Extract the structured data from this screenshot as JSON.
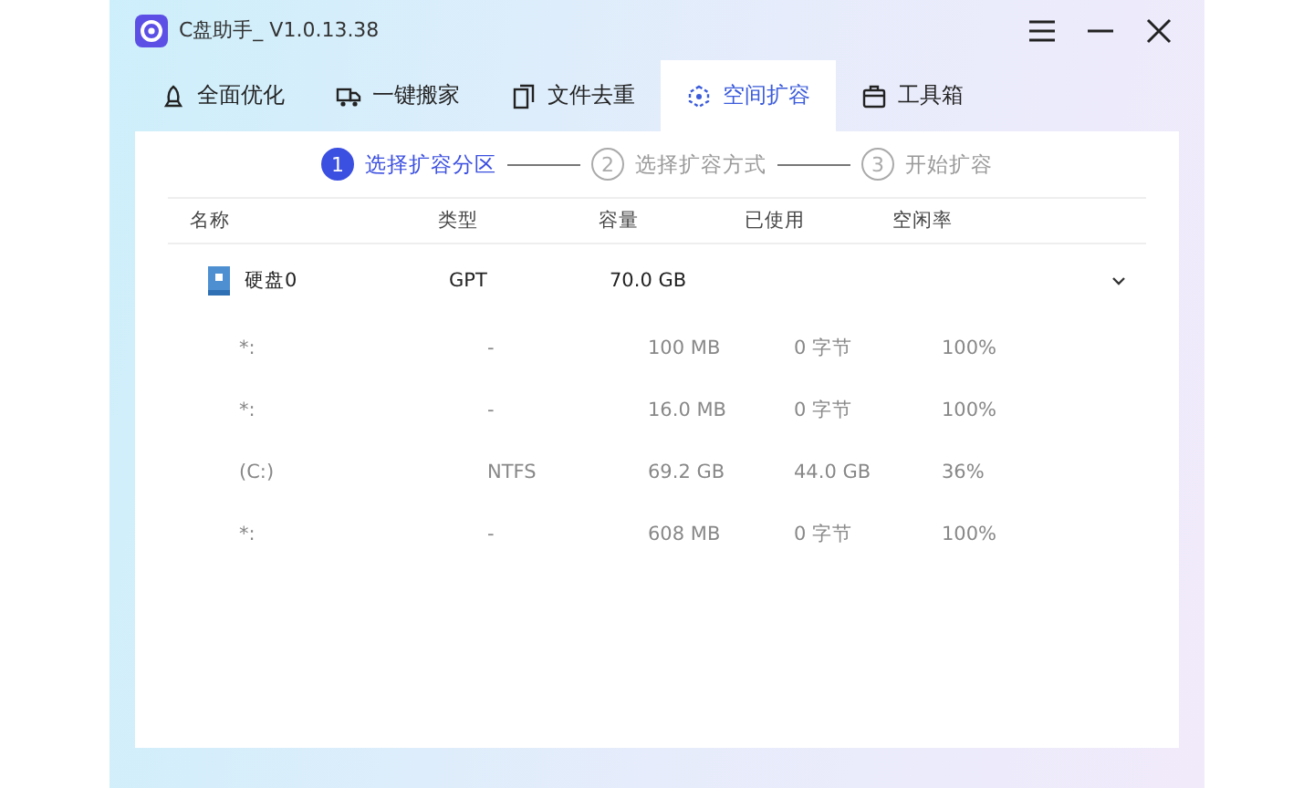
{
  "window": {
    "title": "C盘助手_ V1.0.13.38"
  },
  "tabs": [
    {
      "label": "全面优化",
      "selected": false
    },
    {
      "label": "一键搬家",
      "selected": false
    },
    {
      "label": "文件去重",
      "selected": false
    },
    {
      "label": "空间扩容",
      "selected": true
    },
    {
      "label": "工具箱",
      "selected": false
    }
  ],
  "steps": [
    {
      "number": "1",
      "label": "选择扩容分区",
      "active": true
    },
    {
      "number": "2",
      "label": "选择扩容方式",
      "active": false
    },
    {
      "number": "3",
      "label": "开始扩容",
      "active": false
    }
  ],
  "table": {
    "columns": [
      "名称",
      "类型",
      "容量",
      "已使用",
      "空闲率"
    ],
    "disk": {
      "name": "硬盘0",
      "type": "GPT",
      "capacity": "70.0 GB",
      "expanded": true
    },
    "rows": [
      [
        "*:",
        "-",
        "100 MB",
        "0 字节",
        "100%"
      ],
      [
        "*:",
        "-",
        "16.0 MB",
        "0 字节",
        "100%"
      ],
      [
        "(C:)",
        "NTFS",
        "69.2 GB",
        "44.0 GB",
        "36%"
      ],
      [
        "*:",
        "-",
        "608 MB",
        "0 字节",
        "100%"
      ]
    ]
  }
}
